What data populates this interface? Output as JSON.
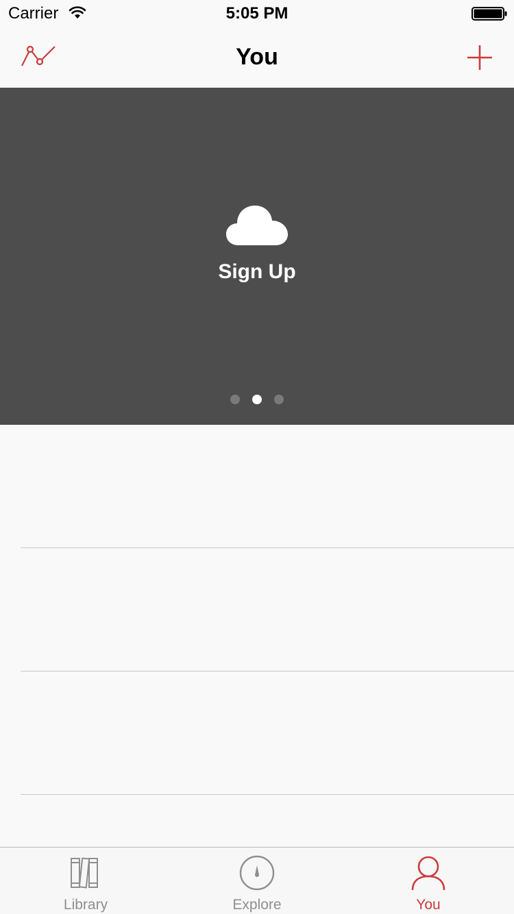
{
  "status_bar": {
    "carrier": "Carrier",
    "time": "5:05 PM"
  },
  "nav": {
    "title": "You",
    "left_icon": "stats-line-icon",
    "right_icon": "plus-icon"
  },
  "banner": {
    "icon": "cloud-icon",
    "label": "Sign Up",
    "page_count": 3,
    "active_page": 2
  },
  "list": {
    "row_count": 3
  },
  "tabs": [
    {
      "label": "Library",
      "icon": "books-icon",
      "selected": false
    },
    {
      "label": "Explore",
      "icon": "compass-icon",
      "selected": false
    },
    {
      "label": "You",
      "icon": "person-icon",
      "selected": true
    }
  ],
  "colors": {
    "accent": "#cc3b3b",
    "banner_bg": "#4d4d4d",
    "tab_inactive": "#8e8e8e"
  }
}
